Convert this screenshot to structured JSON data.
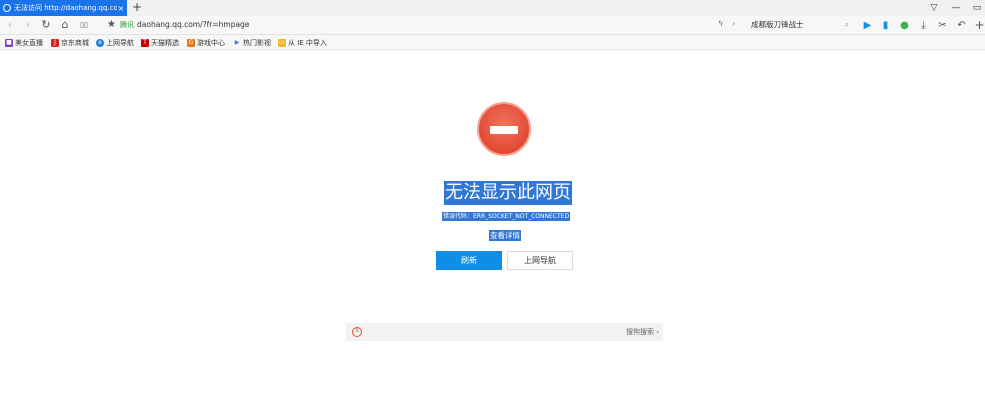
{
  "tab": {
    "title": "无法访问 http://daohang.qq.com/",
    "close": "×",
    "new_tab": "+"
  },
  "window_controls": {
    "shirt": "▽",
    "minimize": "—",
    "restore": "▭"
  },
  "nav": {
    "back": "‹",
    "forward": "›",
    "reload": "↻",
    "home": "⌂",
    "reader": "▯▯",
    "star": "★",
    "secure_label": "腾讯",
    "url": "daohang.qq.com/?fr=hmpage",
    "lightning": "ϟ",
    "arrow": "›"
  },
  "search": {
    "value": "成都版刀锋战士",
    "icon": "search-icon"
  },
  "toolbar": {
    "play": "▶",
    "bookmark": "▮",
    "chat": "●",
    "download": "⤓",
    "cut": "✂",
    "undo": "↶",
    "more": "+"
  },
  "bookmarks": [
    {
      "label": "美女直播",
      "icon": "live-icon",
      "glyph": "■",
      "color": "#7b3fbf"
    },
    {
      "label": "京东商城",
      "icon": "jd-icon",
      "glyph": "J",
      "color": "#d9241c"
    },
    {
      "label": "上网导航",
      "icon": "ie-icon",
      "glyph": "e",
      "color": "#1e7bd8"
    },
    {
      "label": "天猫精选",
      "icon": "tmall-icon",
      "glyph": "T",
      "color": "#c40000"
    },
    {
      "label": "游戏中心",
      "icon": "game-icon",
      "glyph": "G",
      "color": "#e8781c"
    },
    {
      "label": "热门影视",
      "icon": "video-icon",
      "glyph": "▶",
      "color": "#2d7fe0"
    },
    {
      "label": "从 IE 中导入",
      "icon": "folder-icon",
      "glyph": "▭",
      "color": "#f0b62e"
    }
  ],
  "error": {
    "title": "无法显示此网页",
    "code": "错误代码：ERR_SOCKET_NOT_CONNECTED",
    "detail_link": "查看详情",
    "refresh_button": "刷新",
    "nav_button": "上网导航"
  },
  "sogou": {
    "logo": "S",
    "search_label": "搜狗搜索 ›"
  },
  "colors": {
    "accent": "#1a73e8",
    "error_red": "#e24a35",
    "selection": "#3178d6",
    "refresh_button": "#0f8ee8"
  }
}
